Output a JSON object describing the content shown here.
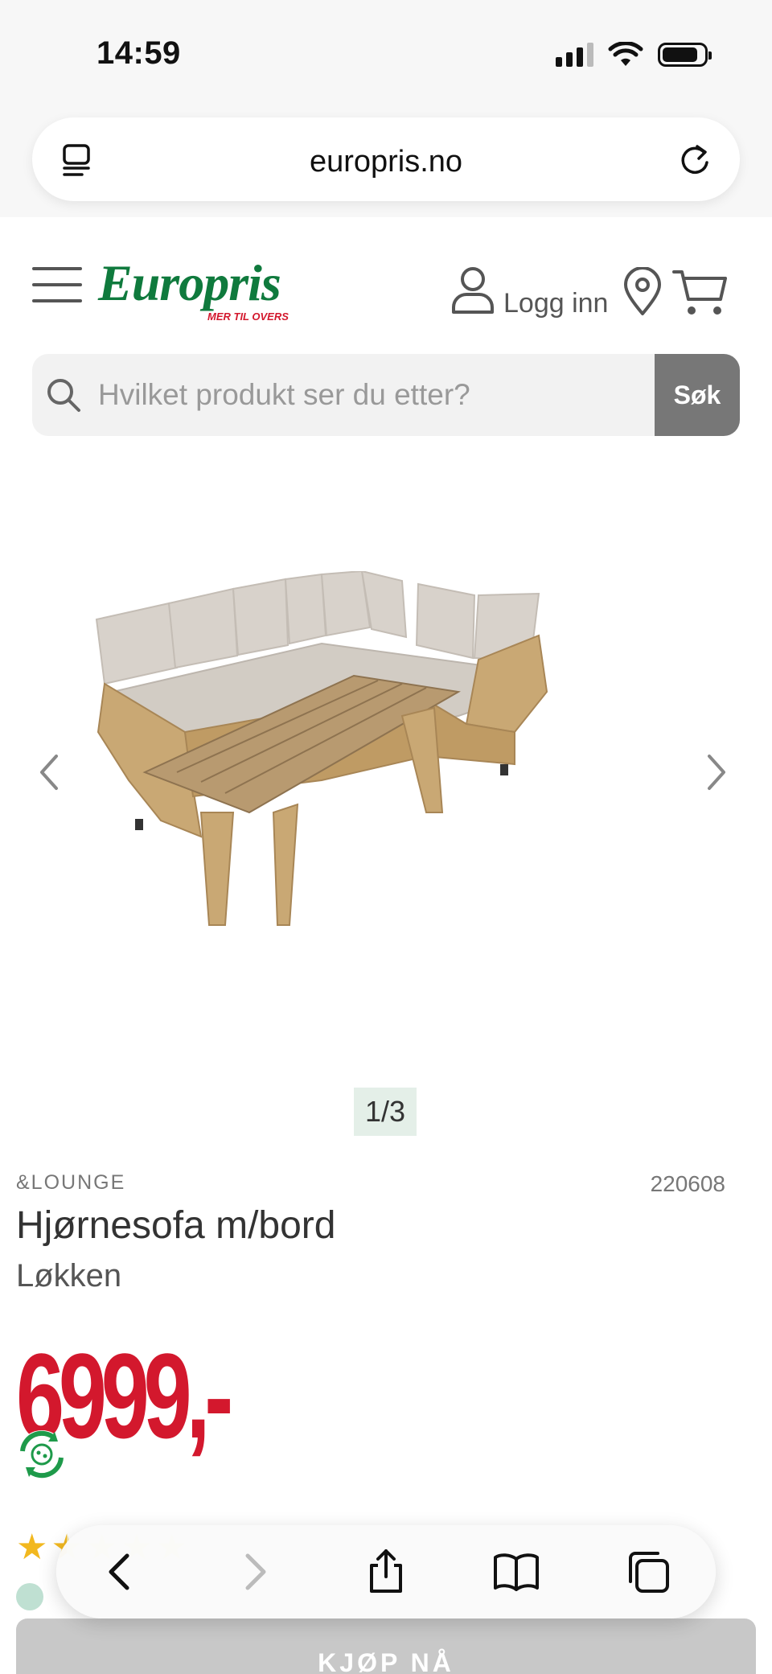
{
  "status_bar": {
    "time": "14:59",
    "battery_level": 0.85,
    "signal_bars": 3
  },
  "browser": {
    "url": "europris.no"
  },
  "header": {
    "logo_text": "Europris",
    "logo_tagline": "MER TIL OVERS",
    "login_label": "Logg inn",
    "colors": {
      "brand_green": "#0f7a3d",
      "brand_red": "#d3182d"
    }
  },
  "search": {
    "placeholder": "Hvilket produkt ser du etter?",
    "button_label": "Søk"
  },
  "gallery": {
    "pagination": "1/3",
    "image_alt": "Hjørnesofa m/bord"
  },
  "product": {
    "brand": "&LOUNGE",
    "sku": "220608",
    "title": "Hjørnesofa m/bord",
    "subtitle": "Løkken",
    "price": "6999,-",
    "rating": 1.5,
    "rating_max": 5
  },
  "actions": {
    "buy_label": "KJØP NÅ"
  },
  "icons": [
    "reader-icon",
    "reload-icon",
    "menu-icon",
    "user-icon",
    "location-icon",
    "cart-icon",
    "search-icon",
    "chevron-left-icon",
    "chevron-right-icon",
    "eco-badge-icon",
    "back-icon",
    "forward-icon",
    "share-icon",
    "bookmarks-icon",
    "tabs-icon"
  ]
}
